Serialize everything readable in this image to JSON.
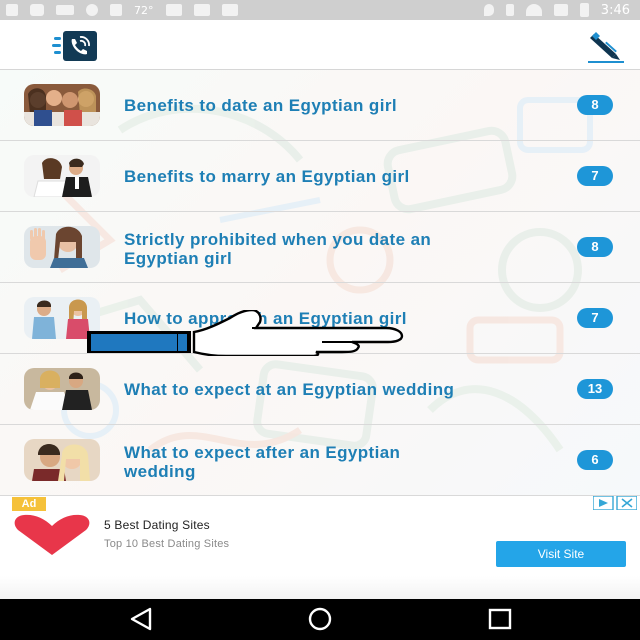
{
  "status_bar": {
    "temperature": "72°",
    "time": "3:46"
  },
  "header": {
    "logo_icon": "phone-chat-icon",
    "edit_icon": "pencil-icon"
  },
  "list": [
    {
      "title": "Benefits to date an Egyptian girl",
      "count": "8",
      "thumb_icon": "group-girls-photo"
    },
    {
      "title": "Benefits to marry an Egyptian girl",
      "count": "7",
      "thumb_icon": "wedding-couple-photo"
    },
    {
      "title_line1": "Strictly prohibited when you date an",
      "title_line2": "Egyptian girl",
      "count": "8",
      "thumb_icon": "stop-hand-girl-photo"
    },
    {
      "title": "How to approach an Egyptian girl",
      "count": "7",
      "thumb_icon": "couple-talking-photo"
    },
    {
      "title": "What to expect at an Egyptian wedding",
      "count": "13",
      "thumb_icon": "bride-groom-photo"
    },
    {
      "title_line1": "What to expect after an Egyptian",
      "title_line2": "wedding",
      "count": "6",
      "thumb_icon": "kissing-couple-photo"
    }
  ],
  "overlay": {
    "icon": "thumbs-up-hand-icon"
  },
  "ad": {
    "badge": "Ad",
    "title": "5 Best Dating Sites",
    "subtitle": "Top 10 Best Dating Sites",
    "cta": "Visit Site",
    "heart_color": "#e8364a",
    "cta_color": "#24a5e8"
  },
  "nav_bar": {
    "back_icon": "back-triangle-icon",
    "home_icon": "home-circle-icon",
    "recents_icon": "recents-square-icon"
  },
  "colors": {
    "title": "#1e7fb5",
    "badge": "#1e96d8"
  }
}
